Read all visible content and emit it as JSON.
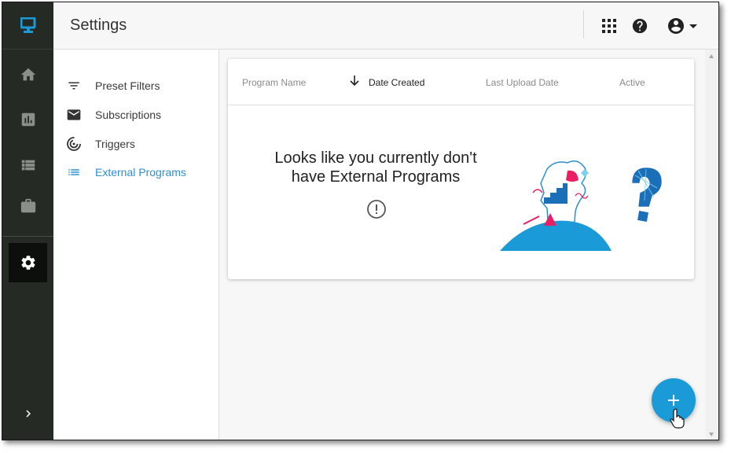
{
  "header": {
    "title": "Settings"
  },
  "rail": {
    "items": [
      {
        "icon": "home-icon"
      },
      {
        "icon": "chart-icon"
      },
      {
        "icon": "list-icon"
      },
      {
        "icon": "briefcase-icon"
      },
      {
        "icon": "gear-icon"
      }
    ],
    "expand_icon": "chevron-right-icon"
  },
  "nav": {
    "items": [
      {
        "label": "Preset Filters",
        "icon": "filter-icon"
      },
      {
        "label": "Subscriptions",
        "icon": "mail-icon"
      },
      {
        "label": "Triggers",
        "icon": "trigger-icon"
      },
      {
        "label": "External Programs",
        "icon": "list-icon",
        "active": true
      }
    ]
  },
  "table": {
    "columns": [
      "Program Name",
      "Date Created",
      "Last Upload Date",
      "Active"
    ],
    "sorted_column": "Date Created",
    "sort_direction": "descending"
  },
  "empty_state": {
    "message_line1": "Looks like you currently don't",
    "message_line2": "have External Programs"
  },
  "colors": {
    "accent": "#2f8fd0",
    "rail": "#262a25",
    "fab": "#1a9ad6",
    "illus_blue": "#1a9ad6",
    "illus_pink": "#e91e63"
  }
}
